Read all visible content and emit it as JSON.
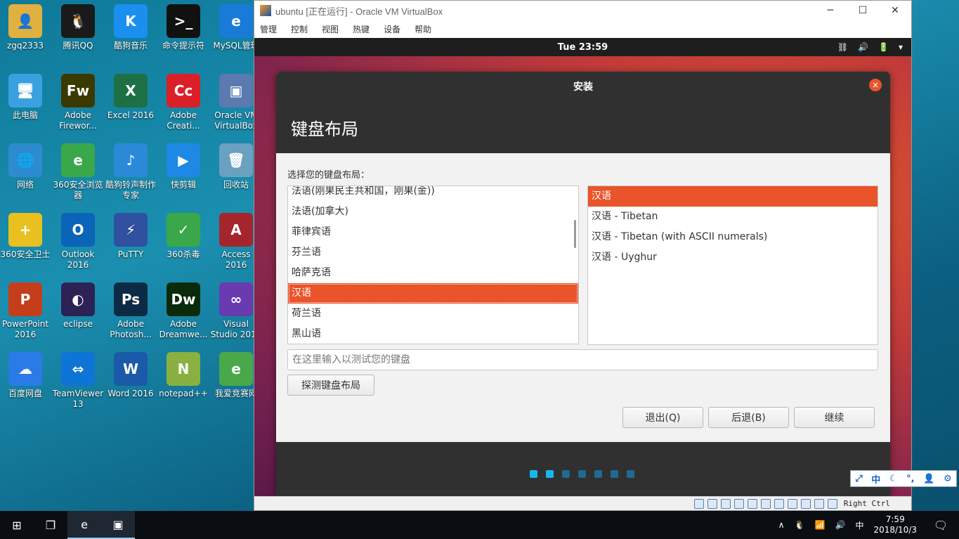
{
  "desktop": {
    "icons": [
      {
        "label": "zgq2333",
        "color": "#e0b040",
        "glyph": "👤"
      },
      {
        "label": "腾讯QQ",
        "color": "#1a1a1a",
        "glyph": "🐧"
      },
      {
        "label": "酷狗音乐",
        "color": "#1a8ff0",
        "glyph": "K"
      },
      {
        "label": "命令提示符",
        "color": "#111111",
        "glyph": ">_"
      },
      {
        "label": "MySQL管理",
        "color": "#1a7ad8",
        "glyph": "e"
      },
      {
        "label": "此电脑",
        "color": "#3ba0e0",
        "glyph": "🖥"
      },
      {
        "label": "Adobe Firewor...",
        "color": "#3a3a00",
        "glyph": "Fw"
      },
      {
        "label": "Excel 2016",
        "color": "#1d7044",
        "glyph": "X"
      },
      {
        "label": "Adobe Creati...",
        "color": "#da1f26",
        "glyph": "Cc"
      },
      {
        "label": "Oracle VM VirtualBox",
        "color": "#5a7ab0",
        "glyph": "▣"
      },
      {
        "label": "网络",
        "color": "#2d8bd0",
        "glyph": "🌐"
      },
      {
        "label": "360安全浏览器",
        "color": "#3aa84a",
        "glyph": "e"
      },
      {
        "label": "酷狗铃声制作专家",
        "color": "#2a8ad8",
        "glyph": "♪"
      },
      {
        "label": "快剪辑",
        "color": "#1e88e5",
        "glyph": "▶"
      },
      {
        "label": "回收站",
        "color": "#6aa0c0",
        "glyph": "🗑"
      },
      {
        "label": "360安全卫士",
        "color": "#e8c020",
        "glyph": "+"
      },
      {
        "label": "Outlook 2016",
        "color": "#0a64b8",
        "glyph": "O"
      },
      {
        "label": "PuTTY",
        "color": "#3050a0",
        "glyph": "⚡"
      },
      {
        "label": "360杀毒",
        "color": "#3aa84a",
        "glyph": "✓"
      },
      {
        "label": "Access 2016",
        "color": "#a4262c",
        "glyph": "A"
      },
      {
        "label": "PowerPoint 2016",
        "color": "#c43e1c",
        "glyph": "P"
      },
      {
        "label": "eclipse",
        "color": "#2c2255",
        "glyph": "◐"
      },
      {
        "label": "Adobe Photosh...",
        "color": "#0c2a44",
        "glyph": "Ps"
      },
      {
        "label": "Adobe Dreamwe...",
        "color": "#0a2a0a",
        "glyph": "Dw"
      },
      {
        "label": "Visual Studio 2017",
        "color": "#6a3ab0",
        "glyph": "∞"
      },
      {
        "label": "百度网盘",
        "color": "#2a7ae8",
        "glyph": "☁"
      },
      {
        "label": "TeamViewer 13",
        "color": "#0e74d6",
        "glyph": "⇔"
      },
      {
        "label": "Word 2016",
        "color": "#1a5aa8",
        "glyph": "W"
      },
      {
        "label": "notepad++",
        "color": "#8ab040",
        "glyph": "N"
      },
      {
        "label": "我爱竞赛网",
        "color": "#4aa84a",
        "glyph": "e"
      }
    ]
  },
  "vbox": {
    "title": "ubuntu [正在运行] - Oracle VM VirtualBox",
    "minimize": "─",
    "maximize": "☐",
    "close": "✕",
    "menu": [
      "管理",
      "控制",
      "视图",
      "热键",
      "设备",
      "帮助"
    ],
    "host_key": "Right Ctrl"
  },
  "gnome": {
    "clock": "Tue 23:59",
    "tray": [
      "⛓",
      "🔊",
      "🔋",
      "▾"
    ]
  },
  "installer": {
    "window_title": "安装",
    "close_glyph": "×",
    "heading": "键盘布局",
    "prompt": "选择您的键盘布局：",
    "languages": [
      "法语(刚果民主共和国，刚果(金))",
      "法语(加拿大)",
      "菲律宾语",
      "芬兰语",
      "哈萨克语",
      "汉语",
      "荷兰语",
      "黑山语"
    ],
    "selected_language_index": 5,
    "variants": [
      "汉语",
      "汉语 - Tibetan",
      "汉语 - Tibetan (with ASCII numerals)",
      "汉语 - Uyghur"
    ],
    "selected_variant_index": 0,
    "test_placeholder": "在这里输入以测试您的键盘",
    "detect_button": "探测键盘布局",
    "quit_button": "退出(Q)",
    "back_button": "后退(B)",
    "continue_button": "继续",
    "progress_steps_total": 7,
    "progress_steps_done": 2
  },
  "ime": [
    "⤢",
    "中",
    "☾",
    "°,",
    "👤",
    "⚙"
  ],
  "taskbar": {
    "start_glyph": "⊞",
    "taskview_glyph": "❐",
    "apps": [
      {
        "name": "360-browser-task",
        "glyph": "e"
      },
      {
        "name": "virtualbox-task",
        "glyph": "▣"
      }
    ],
    "tray_chevron": "∧",
    "tray_qq": "🐧",
    "tray_network": "📶",
    "tray_volume": "🔊",
    "tray_ime": "中",
    "time": "7:59",
    "date": "2018/10/3",
    "notification_glyph": "🗨"
  }
}
